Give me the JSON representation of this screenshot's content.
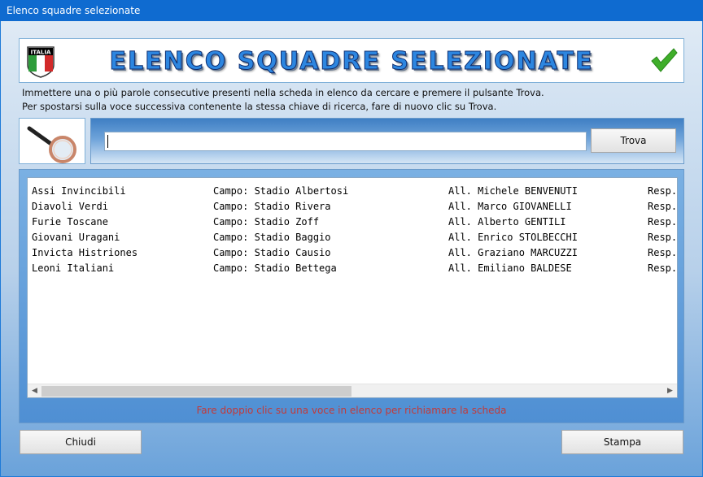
{
  "window": {
    "title": "Elenco squadre selezionate"
  },
  "header": {
    "title": "ELENCO SQUADRE SELEZIONATE",
    "flag_text": "ITALIA",
    "accent_color": "#2d86e0",
    "check_color": "#3fae2a"
  },
  "instructions": {
    "line1": "Immettere una o più parole consecutive presenti nella scheda in elenco da cercare e premere il pulsante Trova.",
    "line2": "Per spostarsi sulla voce successiva contenente la stessa chiave di ricerca, fare di nuovo clic su Trova."
  },
  "search": {
    "value": "",
    "placeholder": "",
    "button_label": "Trova",
    "icon": "magnifier-icon"
  },
  "list": {
    "rows": [
      [
        "Assi Invincibili",
        "Campo: Stadio Albertosi",
        "All. Michele BENVENUTI",
        "Resp."
      ],
      [
        "Diavoli Verdi",
        "Campo: Stadio Rivera",
        "All. Marco GIOVANELLI",
        "Resp."
      ],
      [
        "Furie Toscane",
        "Campo: Stadio Zoff",
        "All. Alberto GENTILI",
        "Resp."
      ],
      [
        "Giovani Uragani",
        "Campo: Stadio Baggio",
        "All. Enrico STOLBECCHI",
        "Resp."
      ],
      [
        "Invicta Histriones",
        "Campo: Stadio Causio",
        "All. Graziano MARCUZZI",
        "Resp."
      ],
      [
        "Leoni Italiani",
        "Campo: Stadio Bettega",
        "All. Emiliano BALDESE",
        "Resp."
      ]
    ],
    "hint": "Fare doppio clic su una voce in elenco per richiamare la scheda",
    "hint_color": "#c23a3a"
  },
  "footer": {
    "close_label": "Chiudi",
    "print_label": "Stampa"
  }
}
